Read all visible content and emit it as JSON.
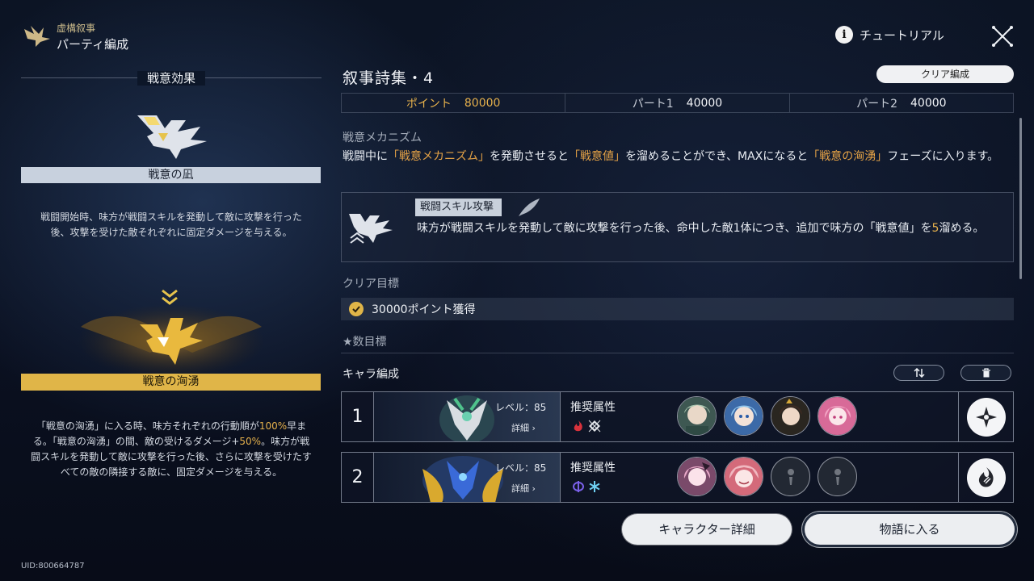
{
  "header": {
    "crumb_top": "虚構叙事",
    "crumb_main": "パーティ編成",
    "tutorial_label": "チュートリアル",
    "info_glyph": "i"
  },
  "left": {
    "section_title": "戦意効果",
    "state1_name": "戦意の凪",
    "state1_desc": "戦闘開始時、味方が戦闘スキルを発動して敵に攻撃を行った後、攻撃を受けた敵それぞれに固定ダメージを与える。",
    "state2_name": "戦意の洶湧",
    "state2_desc_a": "「戦意の洶湧」に入る時、味方それぞれの行動順が",
    "state2_desc_hl1": "100%",
    "state2_desc_b": "早まる。「戦意の洶湧」の間、敵の受けるダメージ+",
    "state2_desc_hl2": "50%",
    "state2_desc_c": "。味方が戦闘スキルを発動して敵に攻撃を行った後、さらに攻撃を受けたすべての敵の隣接する敵に、固定ダメージを与える。",
    "uid": "UID:800664787"
  },
  "stage": {
    "title": "叙事詩集・4",
    "clear_team_label": "クリア編成",
    "scores": [
      {
        "label": "ポイント",
        "value": "80000"
      },
      {
        "label": "パート1",
        "value": "40000"
      },
      {
        "label": "パート2",
        "value": "40000"
      }
    ]
  },
  "mechanism": {
    "label": "戦意メカニズム",
    "t1": "戦闘中に",
    "q1": "「戦意メカニズム」",
    "t2": "を発動させると",
    "q2": "「戦意値」",
    "t3": "を溜めることができ、MAXになると",
    "q3": "「戦意の洶湧」",
    "t4": "フェーズに入ります。",
    "skill_tag": "戦闘スキル攻撃",
    "skill_text_a": "味方が戦闘スキルを発動して敵に攻撃を行った後、命中した敵1体につき、追加で味方の「戦意値」を",
    "skill_text_hl": "5",
    "skill_text_b": "溜める。"
  },
  "goals": {
    "clear_label": "クリア目標",
    "clear_goal": "30000ポイント獲得",
    "star_label": "★数目標"
  },
  "team": {
    "label": "キャラ編成",
    "rows": [
      {
        "num": "1",
        "level": "レベル：85",
        "detail": "詳細 ›",
        "rec": "推奨属性"
      },
      {
        "num": "2",
        "level": "レベル：85",
        "detail": "詳細 ›",
        "rec": "推奨属性"
      }
    ]
  },
  "colors": {
    "accent_gold": "#e6b14c",
    "fire": "#d8323c",
    "imaginary": "#e3e6ea",
    "quantum": "#7a60e8",
    "ice": "#6fd0f2"
  },
  "buttons": {
    "character_detail": "キャラクター詳細",
    "enter_story": "物語に入る"
  }
}
